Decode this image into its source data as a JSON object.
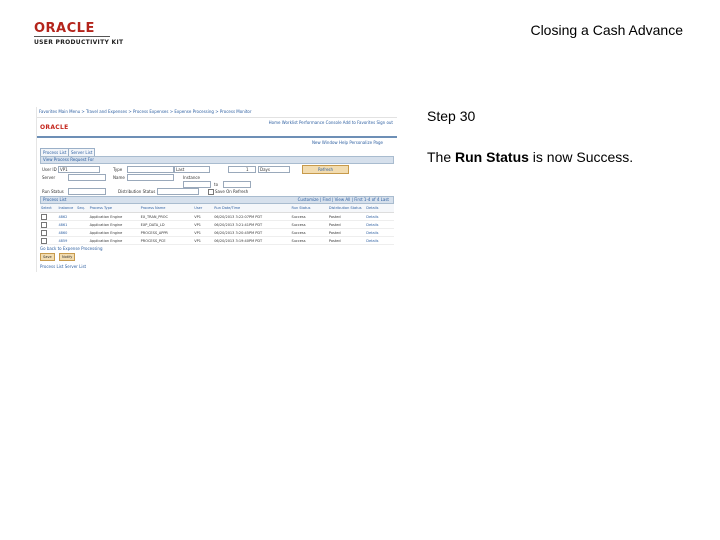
{
  "header": {
    "logo_text": "ORACLE",
    "logo_subtitle": "USER PRODUCTIVITY KIT",
    "title": "Closing a Cash Advance"
  },
  "step": {
    "label": "Step 30",
    "desc_prefix": "The ",
    "desc_bold": "Run Status",
    "desc_suffix": " is now Success."
  },
  "screenshot": {
    "top_nav": "Favorites   Main Menu  >  Travel and Expenses  >  Process Expenses  >  Expense Processing  >  Process Monitor",
    "banner_logo": "ORACLE",
    "banner_links": "Home   Worklist   Performance Console   Add to Favorites   Sign out",
    "sub_links": "New Window   Help   Personalize Page",
    "tabs": [
      "Process List",
      "Server List"
    ],
    "view_section": "View Process Request For",
    "form": {
      "user_id_label": "User ID",
      "user_id_value": "VP1",
      "type_label": "Type",
      "last_label": "Last",
      "last_value": "1",
      "days_value": "Days",
      "refresh_label": "Refresh",
      "server_label": "Server",
      "name_label": "Name",
      "instance_label": "Instance",
      "to_label": "to",
      "run_status_label": "Run Status",
      "dist_status_label": "Distribution Status",
      "save_on_refresh_label": "Save On Refresh"
    },
    "process_list": {
      "title": "Process List",
      "nav": "Customize | Find | View All | First 1-4 of 4 Last",
      "columns": [
        "Select",
        "Instance",
        "Seq.",
        "Process Type",
        "Process Name",
        "User",
        "Run Date/Time",
        "Run Status",
        "Distribution Status",
        "Details"
      ],
      "rows": [
        [
          "",
          "4862",
          "",
          "Application Engine",
          "EX_TRAN_PROC",
          "VP1",
          "06/20/2013 3:22:07PM PDT",
          "Success",
          "Posted",
          "Details"
        ],
        [
          "",
          "4861",
          "",
          "Application Engine",
          "EXP_DATA_LD",
          "VP1",
          "06/20/2013 3:21:41PM PDT",
          "Success",
          "Posted",
          "Details"
        ],
        [
          "",
          "4860",
          "",
          "Application Engine",
          "PROCESS_APPR",
          "VP1",
          "06/20/2013 3:20:45PM PDT",
          "Success",
          "Posted",
          "Details"
        ],
        [
          "",
          "4859",
          "",
          "Application Engine",
          "PROCESS_PCE",
          "VP1",
          "06/20/2013 3:19:40PM PDT",
          "Success",
          "Posted",
          "Details"
        ]
      ]
    },
    "go_back": "Go back to Expense Processing",
    "save_label": "Save",
    "notify_label": "Notify",
    "process_list_link": "Process List   Server List"
  }
}
